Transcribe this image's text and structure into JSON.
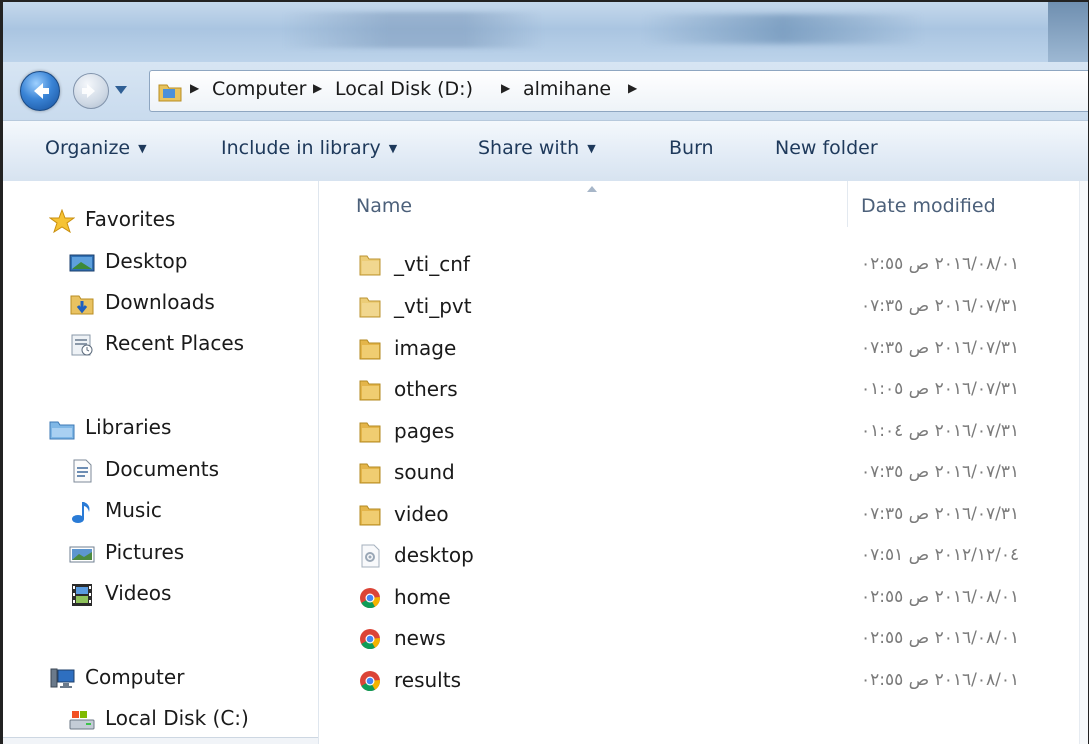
{
  "address": {
    "crumbs": [
      "Computer",
      "Local Disk (D:)",
      "almihane"
    ]
  },
  "toolbar": {
    "organize": "Organize",
    "include_in_library": "Include in library",
    "share_with": "Share with",
    "burn": "Burn",
    "new_folder": "New folder"
  },
  "nav": {
    "favorites": "Favorites",
    "desktop": "Desktop",
    "downloads": "Downloads",
    "recent_places": "Recent Places",
    "libraries": "Libraries",
    "documents": "Documents",
    "music": "Music",
    "pictures": "Pictures",
    "videos": "Videos",
    "computer": "Computer",
    "local_disk_c": "Local Disk (C:)"
  },
  "columns": {
    "name": "Name",
    "date_modified": "Date modified"
  },
  "files": [
    {
      "name": "_vti_cnf",
      "type": "folder",
      "date": "٢٠١٦/٠٨/٠١ ص ٠٢:٥٥"
    },
    {
      "name": "_vti_pvt",
      "type": "folder",
      "date": "٢٠١٦/٠٧/٣١ ص ٠٧:٣٥"
    },
    {
      "name": "image",
      "type": "folder",
      "date": "٢٠١٦/٠٧/٣١ ص ٠٧:٣٥"
    },
    {
      "name": "others",
      "type": "folder",
      "date": "٢٠١٦/٠٧/٣١ ص ٠١:٠٥"
    },
    {
      "name": "pages",
      "type": "folder",
      "date": "٢٠١٦/٠٧/٣١ ص ٠١:٠٤"
    },
    {
      "name": "sound",
      "type": "folder",
      "date": "٢٠١٦/٠٧/٣١ ص ٠٧:٣٥"
    },
    {
      "name": "video",
      "type": "folder",
      "date": "٢٠١٦/٠٧/٣١ ص ٠٧:٣٥"
    },
    {
      "name": "desktop",
      "type": "settings",
      "date": "٢٠١٢/١٢/٠٤ ص ٠٧:٥١"
    },
    {
      "name": "home",
      "type": "chrome",
      "date": "٢٠١٦/٠٨/٠١ ص ٠٢:٥٥"
    },
    {
      "name": "news",
      "type": "chrome",
      "date": "٢٠١٦/٠٨/٠١ ص ٠٢:٥٥"
    },
    {
      "name": "results",
      "type": "chrome",
      "date": "٢٠١٦/٠٨/٠١ ص ٠٢:٥٥"
    }
  ]
}
